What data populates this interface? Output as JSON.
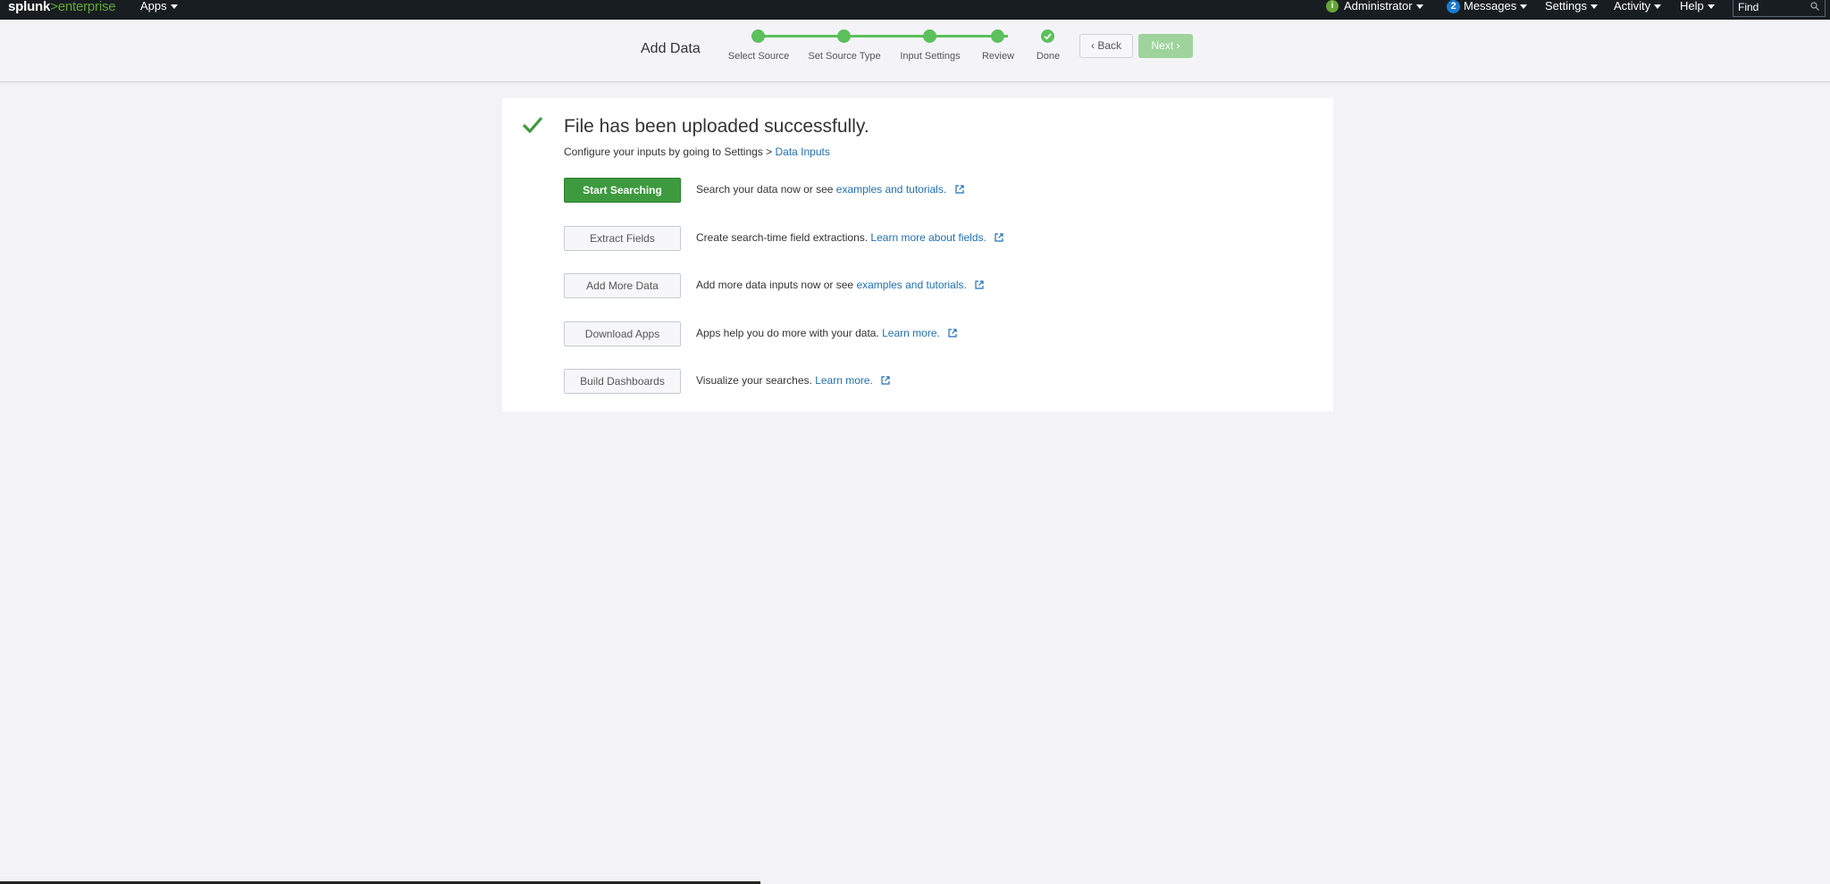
{
  "topbar": {
    "logo_a": "splunk",
    "logo_b": ">",
    "logo_c": "enterprise",
    "apps_label": "Apps",
    "admin_label": "Administrator",
    "messages_count": "2",
    "messages_label": "Messages",
    "settings_label": "Settings",
    "activity_label": "Activity",
    "help_label": "Help",
    "find_placeholder": "Find"
  },
  "header": {
    "title": "Add Data",
    "steps": [
      "Select Source",
      "Set Source Type",
      "Input Settings",
      "Review",
      "Done"
    ],
    "back_label": "Back",
    "next_label": "Next"
  },
  "card": {
    "title": "File has been uploaded successfully.",
    "subtitle_prefix": "Configure your inputs by going to Settings > ",
    "subtitle_link": "Data Inputs",
    "rows": [
      {
        "button": "Start Searching",
        "text": "Search your data now or see ",
        "link": "examples and tutorials."
      },
      {
        "button": "Extract Fields",
        "text": "Create search-time field extractions. ",
        "link": "Learn more about fields."
      },
      {
        "button": "Add More Data",
        "text": "Add more data inputs now or see ",
        "link": "examples and tutorials."
      },
      {
        "button": "Download Apps",
        "text": "Apps help you do more with your data. ",
        "link": "Learn more."
      },
      {
        "button": "Build Dashboards",
        "text": "Visualize your searches. ",
        "link": "Learn more."
      }
    ]
  },
  "colors": {
    "accent_green": "#5cc05c",
    "primary_button": "#3e9a3e",
    "link": "#1e6fb6",
    "topbar": "#171d21"
  }
}
